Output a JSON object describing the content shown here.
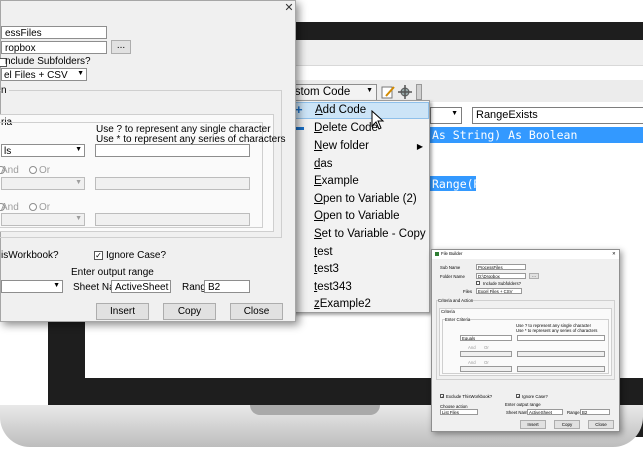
{
  "code_window": {
    "toolbar_dropdown": "Custom Code",
    "object_combo": "",
    "proc_combo": "RangeExists",
    "code_line_1": "As String) As Boolean",
    "code_line_2": "Range(R)"
  },
  "context_menu": {
    "items": [
      {
        "label": "Add Code",
        "underline": "A",
        "rest": "dd Code"
      },
      {
        "label": "Delete Code",
        "underline": "D",
        "rest": "elete Code"
      },
      {
        "label": "New folder",
        "underline": "N",
        "rest": "ew folder"
      },
      {
        "label": "das",
        "underline": "d",
        "rest": "as"
      },
      {
        "label": "Example",
        "underline": "E",
        "rest": "xample"
      },
      {
        "label": "Open to Variable (2)",
        "underline": "O",
        "rest": "pen to Variable (2)"
      },
      {
        "label": "Open to Variable",
        "underline": "O",
        "rest": "pen to Variable"
      },
      {
        "label": "Set to Variable - Copy",
        "underline": "S",
        "rest": "et to Variable - Copy"
      },
      {
        "label": "test",
        "underline": "t",
        "rest": "est"
      },
      {
        "label": "test3",
        "underline": "t",
        "rest": "est3"
      },
      {
        "label": "test343",
        "underline": "t",
        "rest": "est343"
      },
      {
        "label": "zExample2",
        "underline": "z",
        "rest": "Example2"
      }
    ]
  },
  "main_dialog": {
    "sub_name_value": "essFiles",
    "folder_value": "ropbox",
    "browse_label": "...",
    "include_subfolders_label": "nclude Subfolders?",
    "files_value": "el Files + CSV",
    "criteria_group_label": "n",
    "criteria_tab": "ria",
    "wildcard_hint_1": "Use ? to represent any single character",
    "wildcard_hint_2": "Use * to represent any series of characters",
    "criteria_field_1": "ls",
    "and_label": "And",
    "or_label": "Or",
    "exclude_label": "isWorkbook?",
    "ignore_case_label": "Ignore Case?",
    "ignore_case_mark": "✓",
    "output_range_label": "Enter output range",
    "sheet_name_label": "Sheet Name",
    "sheet_name_value": "ActiveSheet",
    "range_label": "Range",
    "range_value": "B2",
    "insert_label": "Insert",
    "copy_label": "Copy",
    "close_label": "Close",
    "close_x": "✕"
  },
  "thumb_dialog": {
    "title": "File Builder",
    "sub_name_label": "Sub Name",
    "sub_name_value": "ProcessFiles",
    "folder_label": "Folder Name",
    "folder_value": "D:\\Dropbox",
    "browse_label": "...",
    "include_subfolders_label": "Include Subfolders?",
    "files_label": "Files",
    "files_value": "Excel Files + CSV",
    "criteria_action_label": "Criteria and Action",
    "criteria_tab": "Criteria",
    "enter_criteria_label": "Enter Criteria",
    "criteria_1_value": "Equals",
    "hint_1": "Use ? to represent any single character",
    "hint_2": "Use * to represent any series of characters",
    "and_label": "And",
    "or_label": "Or",
    "exclude_label": "Exclude ThisWorkbook?",
    "ignore_case_label": "Ignore Case?",
    "check_mark": "✓",
    "choose_action_label": "Choose action",
    "action_value": "List Files",
    "output_range_label": "Enter output range",
    "sheet_name_label": "Sheet Name",
    "sheet_name_value": "ActiveSheet",
    "range_label": "Range",
    "range_value": "B2",
    "insert_label": "Insert",
    "copy_label": "Copy",
    "close_label": "Close",
    "close_x": "✕"
  }
}
